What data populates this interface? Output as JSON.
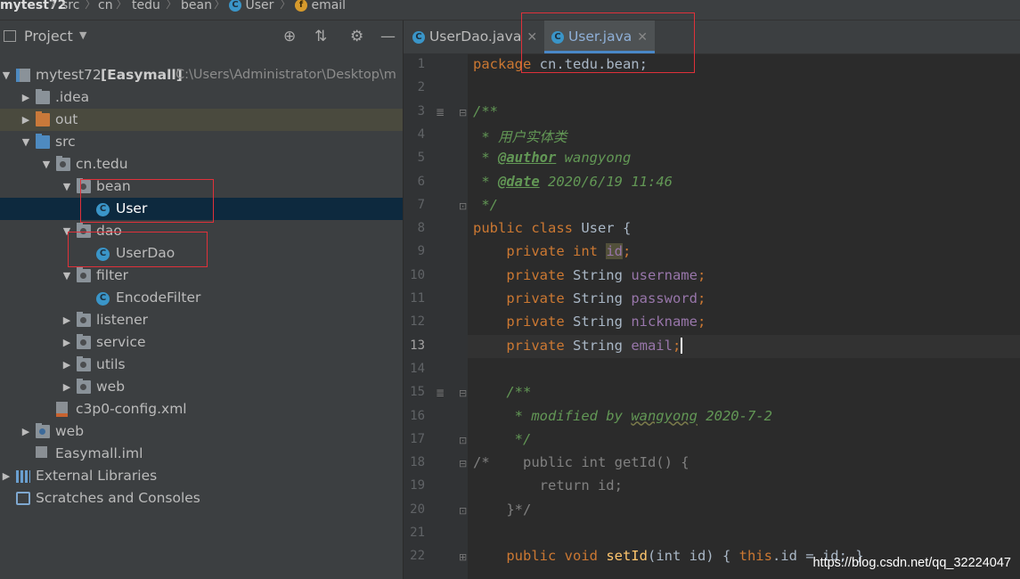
{
  "breadcrumb": {
    "items": [
      "mytest72",
      "src",
      "cn",
      "tedu",
      "bean",
      "User",
      "email"
    ],
    "icons": [
      "",
      "",
      "",
      "",
      "",
      "class-icon",
      "field-icon"
    ]
  },
  "project": {
    "title": "Project",
    "tree": [
      {
        "label": "mytest72",
        "bold_suffix": "[Easymall]",
        "path": "C:\\Users\\Administrator\\Desktop\\m",
        "icon": "module-folder-icon",
        "expanded": true,
        "level": 0
      },
      {
        "label": ".idea",
        "icon": "folder-icon",
        "expanded": false,
        "level": 1
      },
      {
        "label": "out",
        "icon": "folder-icon",
        "expanded": false,
        "level": 1
      },
      {
        "label": "src",
        "icon": "source-folder-icon",
        "expanded": true,
        "level": 1
      },
      {
        "label": "cn.tedu",
        "icon": "package-icon",
        "expanded": true,
        "level": 2
      },
      {
        "label": "bean",
        "icon": "package-icon",
        "expanded": true,
        "level": 3
      },
      {
        "label": "User",
        "icon": "class-icon",
        "level": 4,
        "selected": true
      },
      {
        "label": "dao",
        "icon": "package-icon",
        "expanded": true,
        "level": 3
      },
      {
        "label": "UserDao",
        "icon": "class-icon",
        "level": 4
      },
      {
        "label": "filter",
        "icon": "package-icon",
        "expanded": true,
        "level": 3
      },
      {
        "label": "EncodeFilter",
        "icon": "class-icon",
        "level": 4
      },
      {
        "label": "listener",
        "icon": "package-icon",
        "expanded": false,
        "level": 3
      },
      {
        "label": "service",
        "icon": "package-icon",
        "expanded": false,
        "level": 3
      },
      {
        "label": "utils",
        "icon": "package-icon",
        "expanded": false,
        "level": 3
      },
      {
        "label": "web",
        "icon": "package-icon",
        "expanded": false,
        "level": 3
      },
      {
        "label": "c3p0-config.xml",
        "icon": "xml-file-icon",
        "level": 2
      },
      {
        "label": "web",
        "icon": "web-folder-icon",
        "expanded": false,
        "level": 1
      },
      {
        "label": "Easymall.iml",
        "icon": "iml-file-icon",
        "level": 1
      },
      {
        "label": "External Libraries",
        "icon": "libraries-icon",
        "expanded": false,
        "level": 0
      },
      {
        "label": "Scratches and Consoles",
        "icon": "scratches-icon",
        "level": 0
      }
    ]
  },
  "editor": {
    "tabs": [
      {
        "label": "UserDao.java",
        "active": false
      },
      {
        "label": "User.java",
        "active": true
      }
    ],
    "current_line": 13,
    "lines": [
      "1",
      "2",
      "3",
      "4",
      "5",
      "6",
      "7",
      "8",
      "9",
      "10",
      "11",
      "12",
      "13",
      "14",
      "15",
      "16",
      "17",
      "18",
      "19",
      "20",
      "21",
      "22"
    ],
    "code": {
      "l1_kw": "package",
      "l1_rest": " cn.tedu.bean;",
      "l3": "/**",
      "l4": " * 用户实体类",
      "l5_pre": " * ",
      "l5_tag": "@author",
      "l5_rest": " wangyong",
      "l6_pre": " * ",
      "l6_tag": "@date",
      "l6_rest": " 2020/6/19 11:46",
      "l7": " */",
      "l8_kw": "public class",
      "l8_rest": " User {",
      "l9_kw": "    private int ",
      "l9_field": "id",
      "l9_end": ";",
      "l10_kw": "    private ",
      "l10_type": "String ",
      "l10_field": "username",
      "l11_field": "password",
      "l12_field": "nickname",
      "l13_field": "email",
      "semi": ";",
      "l15": "    /**",
      "l16_pre": "     * modified by ",
      "l16_name": "wangyong",
      "l16_rest": " 2020-7-2",
      "l17": "     */",
      "l18": "/*    public int getId() {",
      "l19": "        return id;",
      "l20": "    }*/",
      "l22_kw": "    public void ",
      "l22_fn": "setId",
      "l22_rest": "(int id) { ",
      "l22_this": "this",
      "l22_end": ".id = id; }"
    }
  },
  "watermark": "https://blog.csdn.net/qq_32224047",
  "colors": {
    "accent": "#4a88c7",
    "highlight_box": "#e0313a",
    "selection": "#0d293e"
  }
}
